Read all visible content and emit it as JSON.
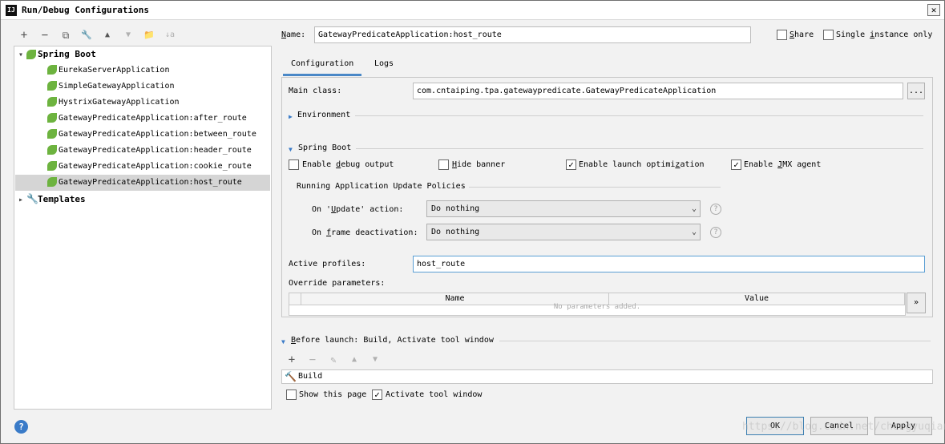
{
  "window": {
    "title": "Run/Debug Configurations",
    "app_icon": "IJ",
    "close_symbol": "✕"
  },
  "toolbar": {
    "icons": [
      {
        "name": "add-icon",
        "glyph": "+"
      },
      {
        "name": "remove-icon",
        "glyph": "−"
      },
      {
        "name": "copy-icon",
        "glyph": "⧉"
      },
      {
        "name": "wrench-icon",
        "glyph": "🔧"
      },
      {
        "name": "move-up-icon",
        "glyph": "▲"
      },
      {
        "name": "move-down-icon",
        "glyph": "▼"
      },
      {
        "name": "folder-icon",
        "glyph": "📁"
      },
      {
        "name": "sort-icon",
        "glyph": "↓a"
      }
    ]
  },
  "tree": {
    "spring_boot": {
      "label": "Spring Boot",
      "arrow": "▾"
    },
    "items": [
      "EurekaServerApplication",
      "SimpleGatewayApplication",
      "HystrixGatewayApplication",
      "GatewayPredicateApplication:after_route",
      "GatewayPredicateApplication:between_route",
      "GatewayPredicateApplication:header_route",
      "GatewayPredicateApplication:cookie_route",
      "GatewayPredicateApplication:host_route"
    ],
    "templates": {
      "label": "Templates",
      "arrow": "▸"
    }
  },
  "form": {
    "name_label_u": "N",
    "name_label_rest": "ame:",
    "name_value": "GatewayPredicateApplication:host_route",
    "share_label_u": "S",
    "share_label_rest": "hare",
    "single_instance_label_a": "Single ",
    "single_instance_label_u": "i",
    "single_instance_label_b": "nstance only"
  },
  "tabs": [
    {
      "label": "Configuration",
      "active": true
    },
    {
      "label": "Logs",
      "active": false
    }
  ],
  "config": {
    "main_class_label": "Main class:",
    "main_class_value": "com.cntaiping.tpa.gatewaypredicate.GatewayPredicateApplication",
    "browse_label": "...",
    "environment_label": "Environment",
    "spring_boot_section": "Spring Boot",
    "enable_debug_a": "Enable ",
    "enable_debug_u": "d",
    "enable_debug_b": "ebug output",
    "hide_banner_u": "H",
    "hide_banner_b": "ide banner",
    "launch_opt_a": "Enable launch optimi",
    "launch_opt_u": "z",
    "launch_opt_b": "ation",
    "jmx_a": "Enable ",
    "jmx_u": "J",
    "jmx_b": "MX agent",
    "policies_label": "Running Application Update Policies",
    "on_update_a": "On '",
    "on_update_u": "U",
    "on_update_b": "pdate' action:",
    "on_update_value": "Do nothing",
    "on_frame_a": "On ",
    "on_frame_u": "f",
    "on_frame_b": "rame deactivation:",
    "on_frame_value": "Do nothing",
    "help_glyph": "?",
    "active_profiles_label": "Active profiles:",
    "active_profiles_value": "host_route",
    "override_label": "Override parameters:",
    "table_headers": [
      "Name",
      "Value"
    ],
    "table_empty": "No parameters added.",
    "expand_btn": "»",
    "check_mark": "✓",
    "checkboxes": {
      "debug": false,
      "hide_banner": false,
      "launch_opt": true,
      "jmx": true
    }
  },
  "before_launch": {
    "label_u": "B",
    "label_rest": "efore launch: Build, Activate tool window",
    "build_label": "Build",
    "show_page_label": "Show this page",
    "activate_label": "Activate tool window",
    "show_page_checked": false,
    "activate_checked": true
  },
  "buttons": {
    "ok": "OK",
    "cancel": "Cancel",
    "apply": "Apply",
    "help": "?"
  },
  "watermark": "https://blog.csdn.net/chengyuqiang"
}
